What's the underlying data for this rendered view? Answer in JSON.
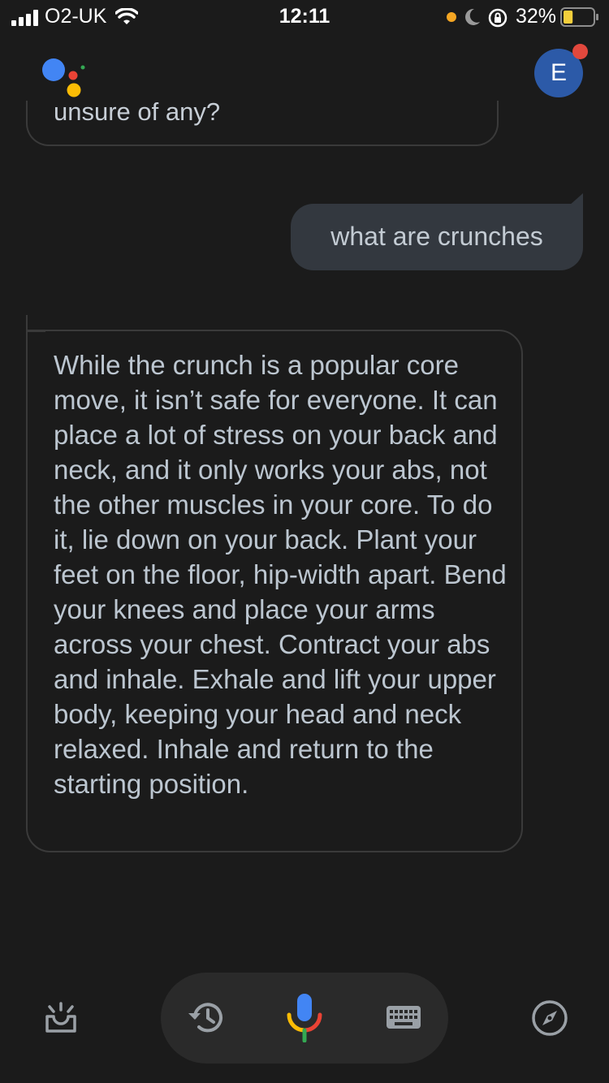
{
  "status_bar": {
    "carrier": "O2-UK",
    "time": "12:11",
    "battery_percent": "32%",
    "battery_level": 0.32
  },
  "header": {
    "avatar_initial": "E"
  },
  "conversation": {
    "previous_bubble_text": "unsure of any?",
    "user_message": "what are crunches",
    "assistant_reply": "While the crunch is a popular core move, it isn’t safe for everyone. It can place a lot of stress on your back and neck, and it only works your abs, not the other muscles in your core. To do it, lie down on your back. Plant your feet on the floor, hip-width apart. Bend your knees and place your arms across your chest. Contract your abs and inhale. Exhale and lift your upper body, keeping your head and neck relaxed. Inhale and return to the starting position."
  },
  "bottom_bar": {
    "icons": [
      "updates-icon",
      "history-icon",
      "mic-icon",
      "keyboard-icon",
      "explore-icon"
    ]
  },
  "colors": {
    "background": "#1b1b1b",
    "user_bubble": "#33383f",
    "text": "#bcc6d0",
    "google_blue": "#4285f4",
    "google_red": "#ea4335",
    "google_yellow": "#fbbc05",
    "google_green": "#34a853"
  }
}
